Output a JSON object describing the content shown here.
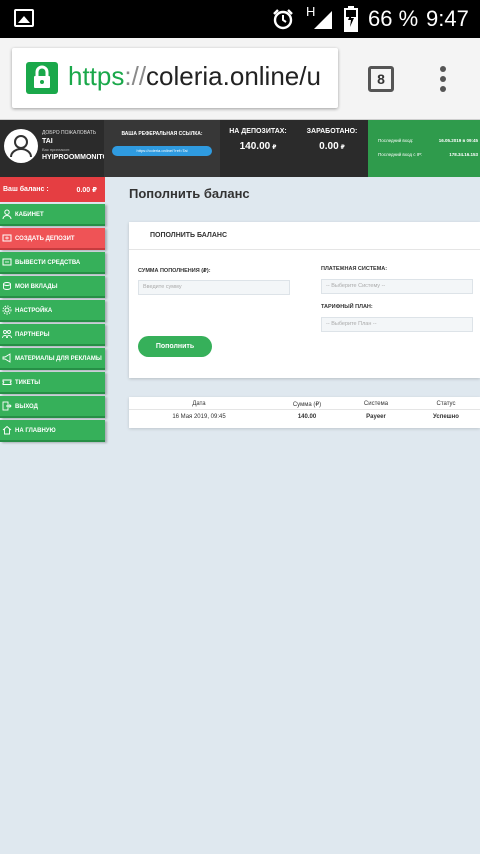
{
  "status_bar": {
    "network": "H",
    "battery_pct": "66 %",
    "time": "9:47"
  },
  "browser": {
    "url_scheme": "https",
    "url_sep": "://",
    "url_host": "coleria.online/u",
    "tab_count": "8"
  },
  "header": {
    "welcome": "ДОБРО ПОЖАЛОВАТЬ",
    "username": "TAI",
    "inviter_label": "Вас пригласил:",
    "inviter": "HYIPROOMMONITOR",
    "referral_title": "ВАША РЕФЕРАЛЬНАЯ ССЫЛКА:",
    "referral_link": "https://coleria.online/?ref=Tai",
    "deposits_label": "НА ДЕПОЗИТАХ:",
    "deposits_value": "140.00",
    "earned_label": "ЗАРАБОТАНО:",
    "earned_value": "0.00",
    "currency": "₽",
    "last_login_label": "Последний вход:",
    "last_login_value": "16.05.2019 в 09:45",
    "last_ip_label": "Последний вход с IP:",
    "last_ip_value": "178.34.16.153"
  },
  "sidebar": {
    "balance_label": "Ваш баланс :",
    "balance_value": "0.00 ₽",
    "items": [
      {
        "label": "КАБИНЕТ",
        "icon": "user-icon"
      },
      {
        "label": "СОЗДАТЬ ДЕПОЗИТ",
        "icon": "deposit-icon"
      },
      {
        "label": "ВЫВЕСТИ СРЕДСТВА",
        "icon": "withdraw-icon"
      },
      {
        "label": "МОИ ВКЛАДЫ",
        "icon": "coins-icon"
      },
      {
        "label": "НАСТРОЙКА",
        "icon": "gear-icon"
      },
      {
        "label": "ПАРТНЕРЫ",
        "icon": "partners-icon"
      },
      {
        "label": "МАТЕРИАЛЫ ДЛЯ РЕКЛАМЫ",
        "icon": "megaphone-icon"
      },
      {
        "label": "ТИКЕТЫ",
        "icon": "ticket-icon"
      },
      {
        "label": "ВЫХОД",
        "icon": "logout-icon"
      },
      {
        "label": "НА ГЛАВНУЮ",
        "icon": "home-icon"
      }
    ]
  },
  "main": {
    "page_title": "Пополнить баланс",
    "form": {
      "title": "ПОПОЛНИТЬ БАЛАНС",
      "amount_label": "СУММА ПОПОЛНЕНИЯ (₽):",
      "amount_placeholder": "Введите сумму",
      "system_label": "ПЛАТЕЖНАЯ СИСТЕМА:",
      "system_value": "-- Выберите Систему --",
      "plan_label": "ТАРИФНЫЙ ПЛАН:",
      "plan_value": "-- Выберите План --",
      "submit_label": "Пополнить"
    },
    "history": {
      "columns": [
        "Дата",
        "Сумма (₽)",
        "Система",
        "Статус"
      ],
      "rows": [
        [
          "16 Мая 2019, 09:45",
          "140.00",
          "Payeer",
          "Успешно"
        ]
      ]
    }
  },
  "colors": {
    "green": "#36b05a",
    "red": "#e53e42",
    "dark": "#2b2b2b",
    "blue": "#2f9be0"
  }
}
